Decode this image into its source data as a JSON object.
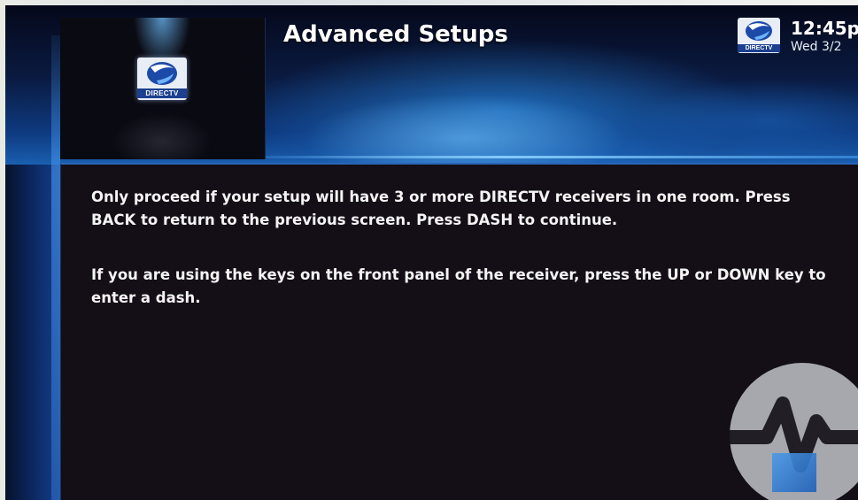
{
  "header": {
    "title": "Advanced Setups",
    "logo_text": "DIRECTV"
  },
  "clock": {
    "time": "12:45p",
    "date": "Wed 3/2",
    "logo_text": "DIRECTV"
  },
  "message": {
    "paragraph_1": "Only proceed if your setup will have 3 or more DIRECTV receivers in one room. Press BACK to return to the previous screen.  Press DASH to continue.",
    "paragraph_2": "If you are using the keys on the front panel of the receiver, press the UP or DOWN key to enter a dash."
  },
  "colors": {
    "accent_blue": "#2b64b8",
    "panel_bg": "#140e16",
    "text": "#f4f4f4"
  },
  "icons": {
    "brand_logo": "directv-logo-icon",
    "watermark": "watermark-icon"
  }
}
